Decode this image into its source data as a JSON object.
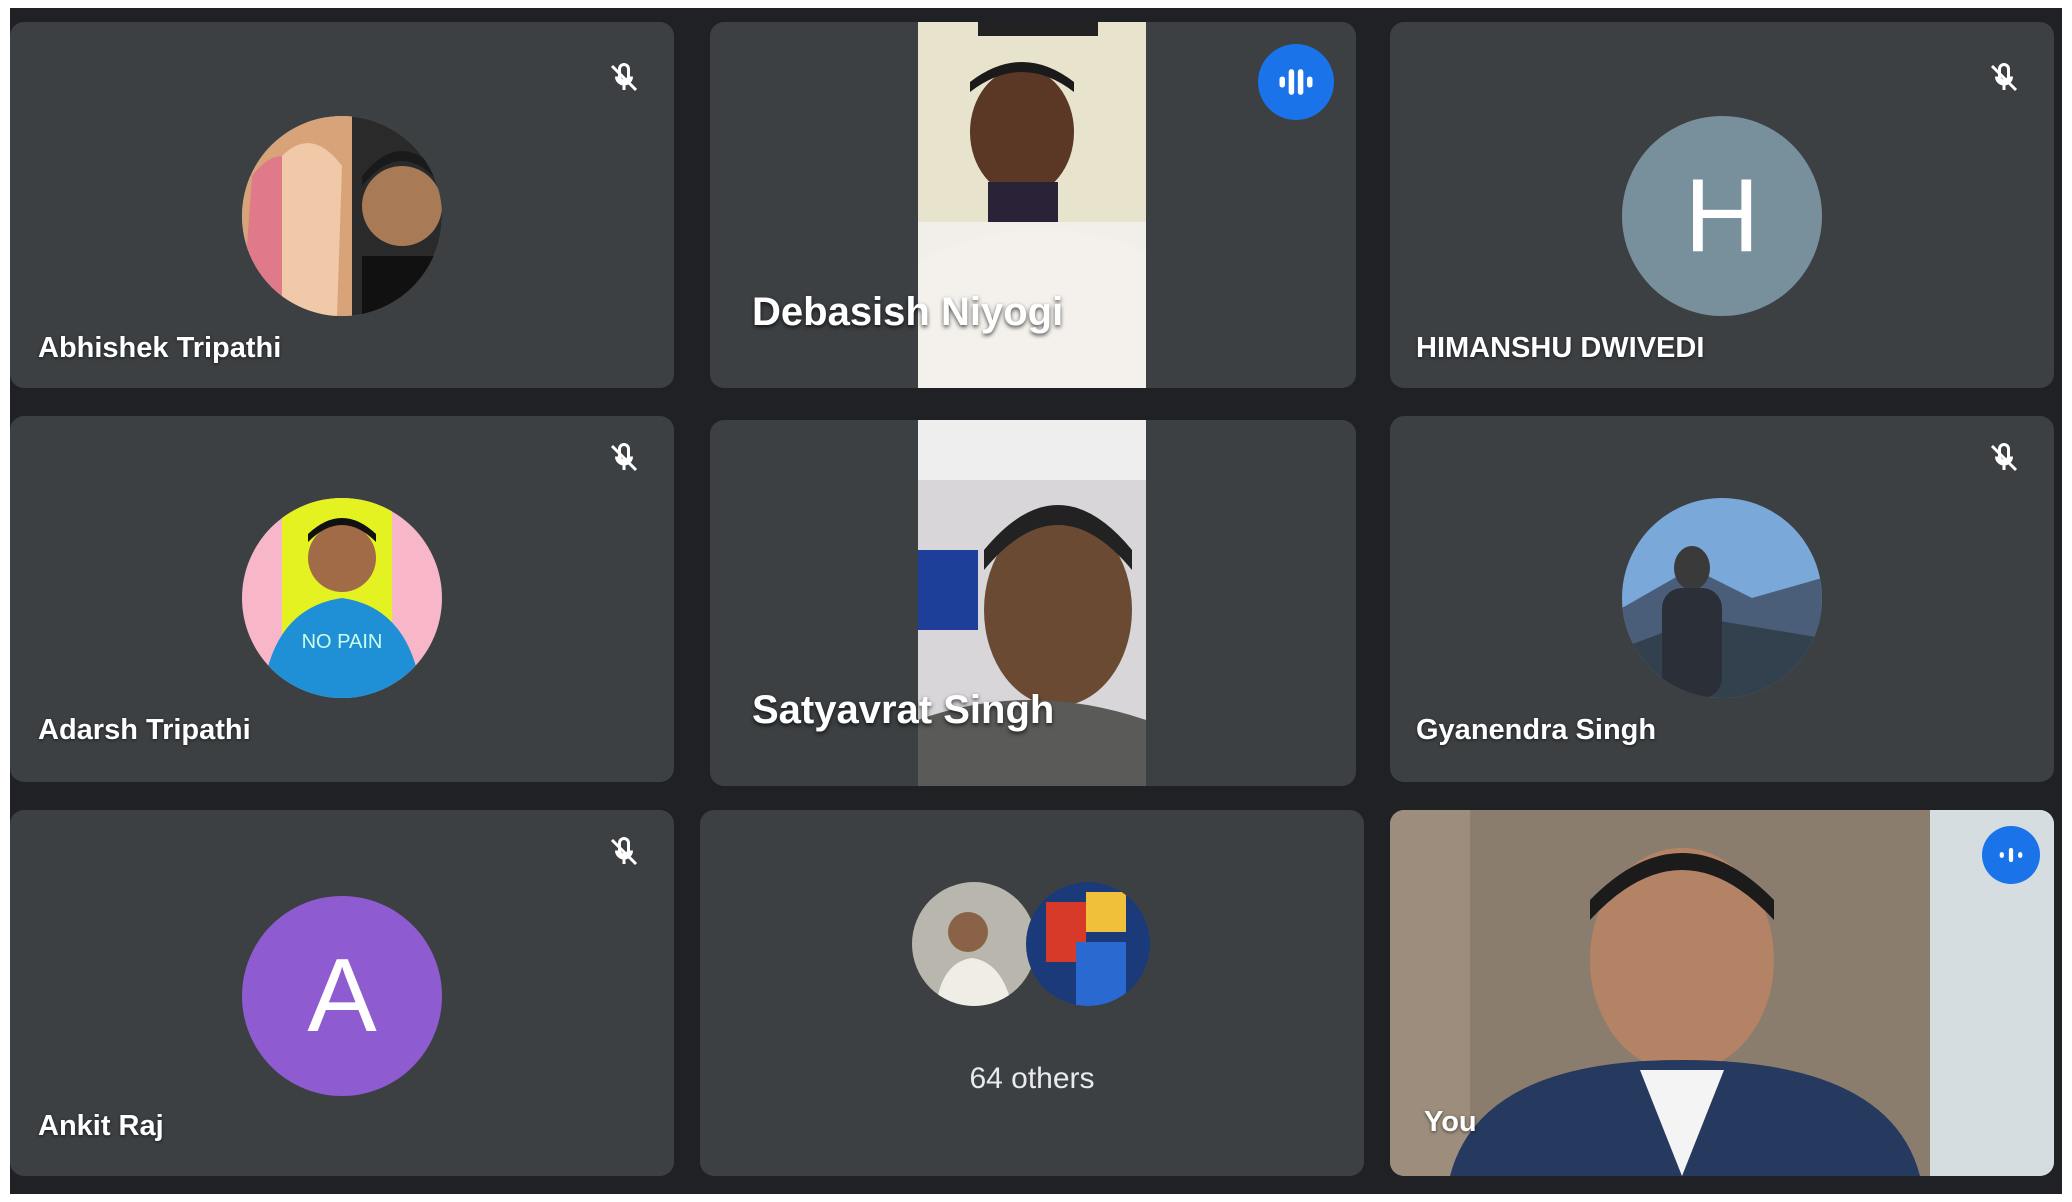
{
  "participants": [
    {
      "name": "Abhishek Tripathi",
      "muted": true,
      "avatar_type": "photo"
    },
    {
      "name": "Debasish Niyogi",
      "muted": false,
      "speaking": true,
      "avatar_type": "video"
    },
    {
      "name": "HIMANSHU DWIVEDI",
      "muted": true,
      "avatar_type": "letter",
      "letter": "H",
      "color": "#78909c"
    },
    {
      "name": "Adarsh Tripathi",
      "muted": true,
      "avatar_type": "photo"
    },
    {
      "name": "Satyavrat Singh",
      "muted": false,
      "avatar_type": "video"
    },
    {
      "name": "Gyanendra Singh",
      "muted": true,
      "avatar_type": "photo"
    },
    {
      "name": "Ankit Raj",
      "muted": true,
      "avatar_type": "letter",
      "letter": "A",
      "color": "#8e5cd0"
    }
  ],
  "others": {
    "label": "64 others"
  },
  "self": {
    "name": "You",
    "speaking": true
  },
  "colors": {
    "background": "#202124",
    "tile": "#3c4043",
    "speaking_indicator": "#1a73e8"
  }
}
